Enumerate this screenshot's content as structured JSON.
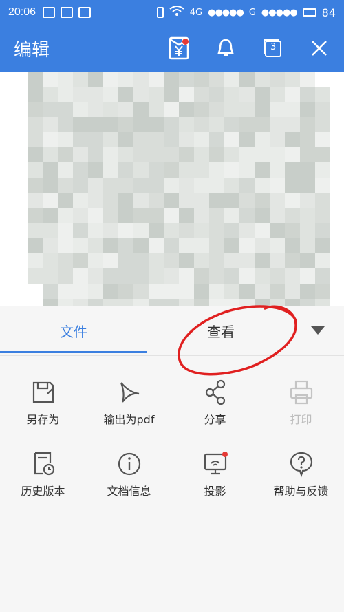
{
  "status_bar": {
    "time": "20:06",
    "network_1": "4G",
    "network_2": "G",
    "battery": "84"
  },
  "app_bar": {
    "title": "编辑",
    "actions": [
      {
        "icon": "wallet-yen-icon",
        "badge": true
      },
      {
        "icon": "bell-icon",
        "badge": false
      },
      {
        "icon": "tabs-count-icon",
        "count": "3"
      },
      {
        "icon": "close-icon",
        "badge": false
      }
    ]
  },
  "document": {
    "lines": [
      "",
      "",
      "",
      "",
      "",
      "",
      "",
      "",
      "",
      "",
      ""
    ]
  },
  "tabs": {
    "items": [
      {
        "label": "文件",
        "active": true
      },
      {
        "label": "查看",
        "active": false
      }
    ]
  },
  "menu": {
    "row1": [
      {
        "label": "另存为",
        "icon": "save-as-icon",
        "enabled": true
      },
      {
        "label": "输出为pdf",
        "icon": "export-pdf-icon",
        "enabled": true
      },
      {
        "label": "分享",
        "icon": "share-icon",
        "enabled": true
      },
      {
        "label": "打印",
        "icon": "print-icon",
        "enabled": false
      }
    ],
    "row2": [
      {
        "label": "历史版本",
        "icon": "history-version-icon",
        "enabled": true
      },
      {
        "label": "文档信息",
        "icon": "info-icon",
        "enabled": true
      },
      {
        "label": "投影",
        "icon": "projection-icon",
        "enabled": true
      },
      {
        "label": "帮助与反馈",
        "icon": "help-icon",
        "enabled": true
      }
    ]
  },
  "colors": {
    "primary": "#3b7fe0",
    "annotation": "#e02020",
    "badge": "#e53935"
  }
}
